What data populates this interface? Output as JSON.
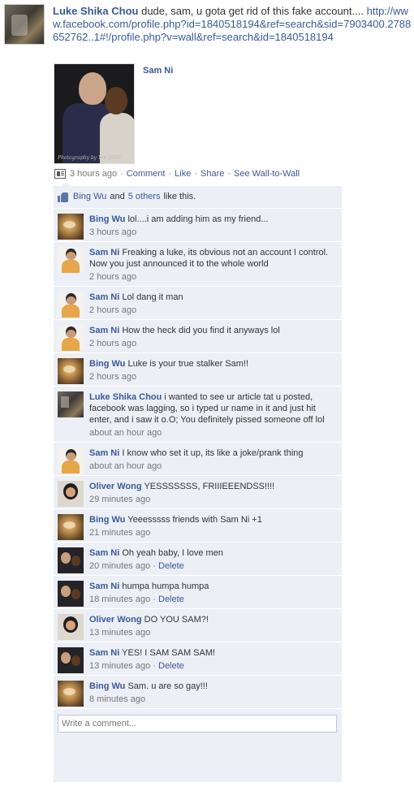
{
  "post": {
    "author": "Luke Shika Chou",
    "message": "dude, sam, u gota get rid of this fake account....",
    "url": "http://www.facebook.com/profile.php?id=1840518194&ref=search&sid=7903400.2788652762..1#!/profile.php?v=wall&ref=search&id=1840518194",
    "attachment_name": "Sam Ni",
    "attachment_caption": "Photography by Yee 2009",
    "time": "3 hours ago",
    "actions": [
      "Comment",
      "Like",
      "Share",
      "See Wall-to-Wall"
    ]
  },
  "likes": {
    "name": "Bing Wu",
    "and": "and",
    "others": "5 others",
    "suffix": "like this."
  },
  "comments": [
    {
      "author": "Bing Wu",
      "avatar": "bing",
      "text": "lol....i am adding him as my friend...",
      "time": "3 hours ago",
      "delete": ""
    },
    {
      "author": "Sam Ni",
      "avatar": "sam1",
      "text": "Freaking a luke, its obvious not an account I control. Now you just announced it to the whole world",
      "time": "2 hours ago",
      "delete": ""
    },
    {
      "author": "Sam Ni",
      "avatar": "sam1",
      "text": "Lol dang it man",
      "time": "2 hours ago",
      "delete": ""
    },
    {
      "author": "Sam Ni",
      "avatar": "sam1",
      "text": "How the heck did you find it anyways lol",
      "time": "2 hours ago",
      "delete": ""
    },
    {
      "author": "Bing Wu",
      "avatar": "bing",
      "text": "Luke is your true stalker Sam!!",
      "time": "2 hours ago",
      "delete": ""
    },
    {
      "author": "Luke Shika Chou",
      "avatar": "luke",
      "text": "i wanted to see ur article tat u posted, facebook was lagging, so i typed ur name in it and just hit enter, and i saw it o.O; You definitely pissed someone off lol",
      "time": "about an hour ago",
      "delete": ""
    },
    {
      "author": "Sam Ni",
      "avatar": "sam1",
      "text": "I know who set it up, its like a joke/prank thing",
      "time": "about an hour ago",
      "delete": ""
    },
    {
      "author": "Oliver Wong",
      "avatar": "oliver",
      "text": "YESSSSSSS, FRIIIEEENDSS!!!!",
      "time": "29 minutes ago",
      "delete": ""
    },
    {
      "author": "Bing Wu",
      "avatar": "bing",
      "text": "Yeeesssss friends with Sam Ni +1",
      "time": "21 minutes ago",
      "delete": ""
    },
    {
      "author": "Sam Ni",
      "avatar": "sam2",
      "text": "Oh yeah baby, I love men",
      "time": "20 minutes ago",
      "delete": "Delete"
    },
    {
      "author": "Sam Ni",
      "avatar": "sam2",
      "text": "humpa humpa humpa",
      "time": "18 minutes ago",
      "delete": "Delete"
    },
    {
      "author": "Oliver Wong",
      "avatar": "oliver",
      "text": "DO YOU SAM?!",
      "time": "13 minutes ago",
      "delete": ""
    },
    {
      "author": "Sam Ni",
      "avatar": "sam2",
      "text": "YES! I SAM SAM SAM!",
      "time": "13 minutes ago",
      "delete": "Delete"
    },
    {
      "author": "Bing Wu",
      "avatar": "bing",
      "text": "Sam. u are so gay!!!",
      "time": "8 minutes ago",
      "delete": ""
    }
  ],
  "write_comment": {
    "placeholder": "Write a comment..."
  },
  "colors": {
    "link": "#3b5998",
    "ufi_bg": "#eceff5",
    "meta": "#777777"
  },
  "icons": [
    "wall-to-wall-icon",
    "like-thumb-icon"
  ]
}
